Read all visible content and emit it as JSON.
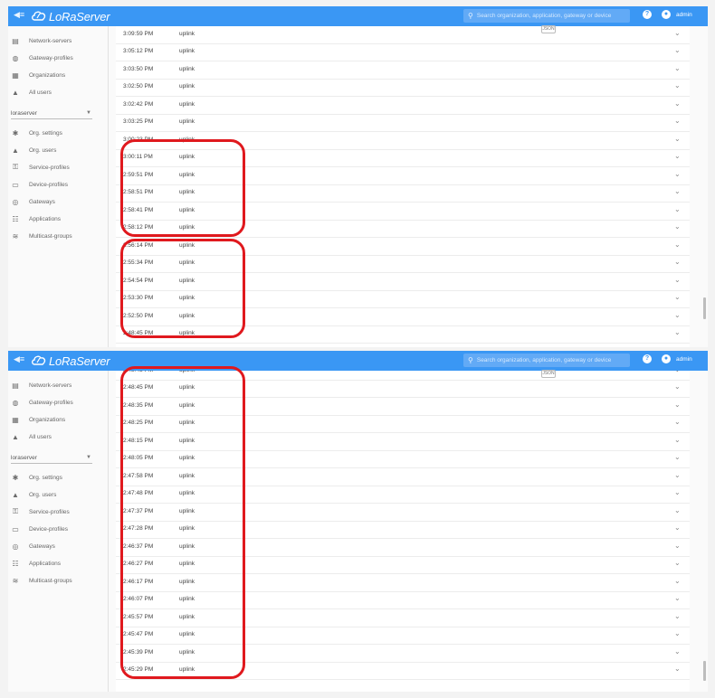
{
  "app": {
    "logo_text": "LoRaServer",
    "menu_icon": "menu-icon"
  },
  "header": {
    "search_placeholder": "Search organization, application, gateway or device",
    "help_icon": "help-icon",
    "user_icon": "account-icon",
    "user_name": "admin"
  },
  "sidebar": {
    "admin_items": [
      {
        "label": "Network-servers",
        "icon": "server-icon"
      },
      {
        "label": "Gateway-profiles",
        "icon": "gateway-profile-icon"
      },
      {
        "label": "Organizations",
        "icon": "domain-icon"
      },
      {
        "label": "All users",
        "icon": "user-icon"
      }
    ],
    "org_select_value": "loraserver",
    "org_items": [
      {
        "label": "Org. settings",
        "icon": "settings-icon"
      },
      {
        "label": "Org. users",
        "icon": "user-icon"
      },
      {
        "label": "Service-profiles",
        "icon": "service-profile-icon"
      },
      {
        "label": "Device-profiles",
        "icon": "device-profile-icon"
      },
      {
        "label": "Gateways",
        "icon": "gateway-icon"
      },
      {
        "label": "Applications",
        "icon": "applications-icon"
      },
      {
        "label": "Multicast-groups",
        "icon": "rss-icon"
      }
    ]
  },
  "panel_tag": "JSON",
  "frames": [
    {
      "rows": [
        {
          "time": "3:09:59 PM",
          "type": "uplink"
        },
        {
          "time": "3:05:12 PM",
          "type": "uplink"
        },
        {
          "time": "3:03:50 PM",
          "type": "uplink"
        },
        {
          "time": "3:02:50 PM",
          "type": "uplink"
        },
        {
          "time": "3:02:42 PM",
          "type": "uplink"
        },
        {
          "time": "3:03:25 PM",
          "type": "uplink"
        },
        {
          "time": "3:00:23 PM",
          "type": "uplink"
        },
        {
          "time": "3:00:11 PM",
          "type": "uplink"
        },
        {
          "time": "2:59:51 PM",
          "type": "uplink"
        },
        {
          "time": "2:58:51 PM",
          "type": "uplink"
        },
        {
          "time": "2:58:41 PM",
          "type": "uplink"
        },
        {
          "time": "2:58:12 PM",
          "type": "uplink"
        },
        {
          "time": "2:56:14 PM",
          "type": "uplink"
        },
        {
          "time": "2:55:34 PM",
          "type": "uplink"
        },
        {
          "time": "2:54:54 PM",
          "type": "uplink"
        },
        {
          "time": "2:53:30 PM",
          "type": "uplink"
        },
        {
          "time": "2:52:50 PM",
          "type": "uplink"
        },
        {
          "time": "2:48:45 PM",
          "type": "uplink"
        }
      ]
    },
    {
      "rows": [
        {
          "time": "2:48:45 PM",
          "type": "uplink"
        },
        {
          "time": "2:48:45 PM",
          "type": "uplink"
        },
        {
          "time": "2:48:35 PM",
          "type": "uplink"
        },
        {
          "time": "2:48:25 PM",
          "type": "uplink"
        },
        {
          "time": "2:48:15 PM",
          "type": "uplink"
        },
        {
          "time": "2:48:05 PM",
          "type": "uplink"
        },
        {
          "time": "2:47:58 PM",
          "type": "uplink"
        },
        {
          "time": "2:47:48 PM",
          "type": "uplink"
        },
        {
          "time": "2:47:37 PM",
          "type": "uplink"
        },
        {
          "time": "2:47:28 PM",
          "type": "uplink"
        },
        {
          "time": "2:46:37 PM",
          "type": "uplink"
        },
        {
          "time": "2:46:27 PM",
          "type": "uplink"
        },
        {
          "time": "2:46:17 PM",
          "type": "uplink"
        },
        {
          "time": "2:46:07 PM",
          "type": "uplink"
        },
        {
          "time": "2:45:57 PM",
          "type": "uplink"
        },
        {
          "time": "2:45:47 PM",
          "type": "uplink"
        },
        {
          "time": "2:45:39 PM",
          "type": "uplink"
        },
        {
          "time": "2:45:29 PM",
          "type": "uplink"
        }
      ]
    }
  ],
  "colors": {
    "appbar": "#3a97f4",
    "annotation": "#e0191e"
  }
}
